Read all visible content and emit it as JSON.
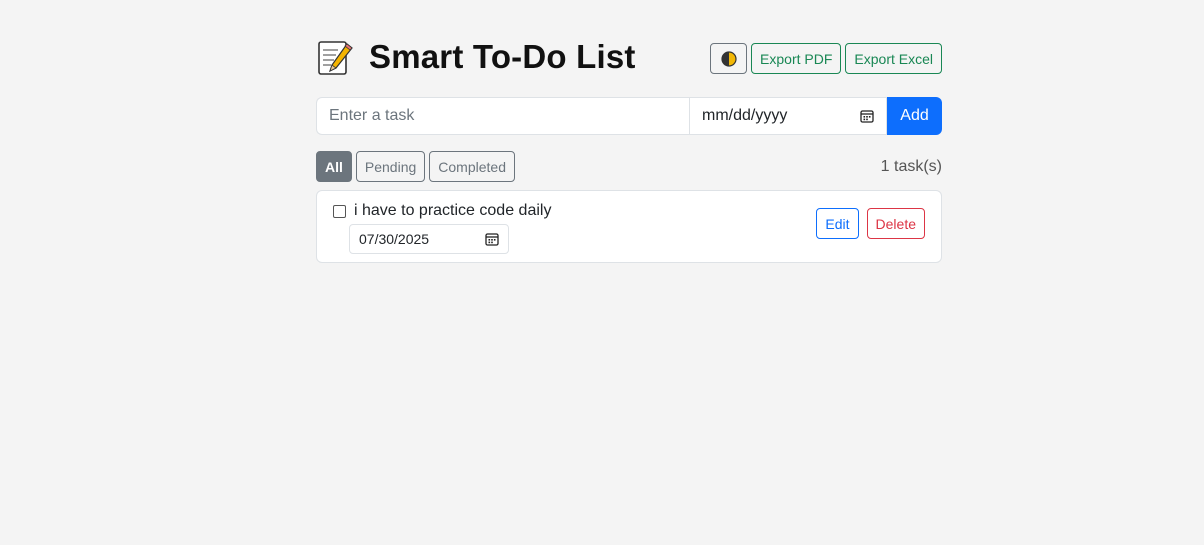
{
  "header": {
    "title": "Smart To-Do List",
    "theme_icon": "half-circle-icon",
    "memo_icon": "memo-icon",
    "export_pdf_label": "Export PDF",
    "export_excel_label": "Export Excel"
  },
  "add_form": {
    "task_placeholder": "Enter a task",
    "date_placeholder": "mm/dd/yyyy",
    "add_label": "Add"
  },
  "filters": {
    "items": [
      {
        "label": "All",
        "active": true
      },
      {
        "label": "Pending",
        "active": false
      },
      {
        "label": "Completed",
        "active": false
      }
    ],
    "count_text": "1 task(s)"
  },
  "tasks": [
    {
      "text": "i have to practice code daily",
      "date": "07/30/2025",
      "completed": false,
      "edit_label": "Edit",
      "delete_label": "Delete"
    }
  ],
  "colors": {
    "primary": "#0d6efd",
    "success": "#198754",
    "danger": "#dc3545",
    "secondary": "#6c757d",
    "background": "#f4f4f4"
  }
}
